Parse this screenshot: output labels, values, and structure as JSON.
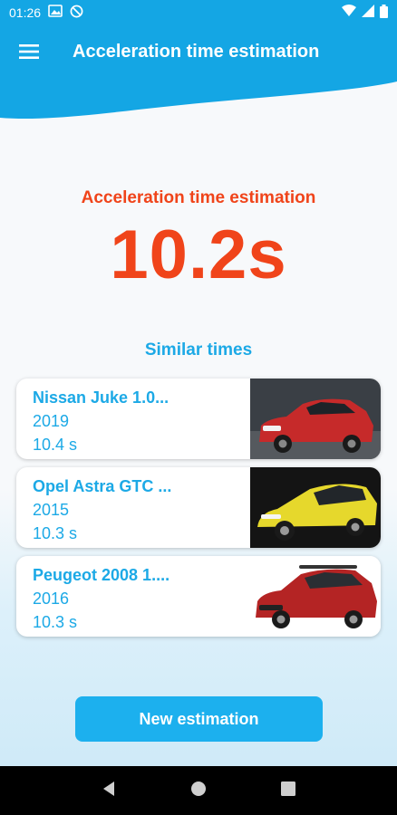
{
  "status_bar": {
    "time": "01:26",
    "icons": [
      "image-icon",
      "dnd-icon",
      "wifi-icon",
      "signal-icon",
      "battery-icon"
    ]
  },
  "header": {
    "title": "Acceleration time estimation",
    "menu_icon": "hamburger-menu-icon"
  },
  "estimation": {
    "label": "Acceleration time estimation",
    "value": "10.2s"
  },
  "similar": {
    "title": "Similar times",
    "cars": [
      {
        "name": "Nissan Juke 1.0...",
        "year": "2019",
        "time": "10.4 s",
        "color": "#c62a2a"
      },
      {
        "name": "Opel Astra GTC ...",
        "year": "2015",
        "time": "10.3 s",
        "color": "#e6d82c"
      },
      {
        "name": "Peugeot 2008 1....",
        "year": "2016",
        "time": "10.3 s",
        "color": "#b42424"
      }
    ]
  },
  "actions": {
    "new_estimation": "New estimation"
  },
  "colors": {
    "accent_blue": "#1ca9e6",
    "accent_orange": "#f0441a"
  },
  "nav": [
    "back-icon",
    "home-icon",
    "recents-icon"
  ]
}
